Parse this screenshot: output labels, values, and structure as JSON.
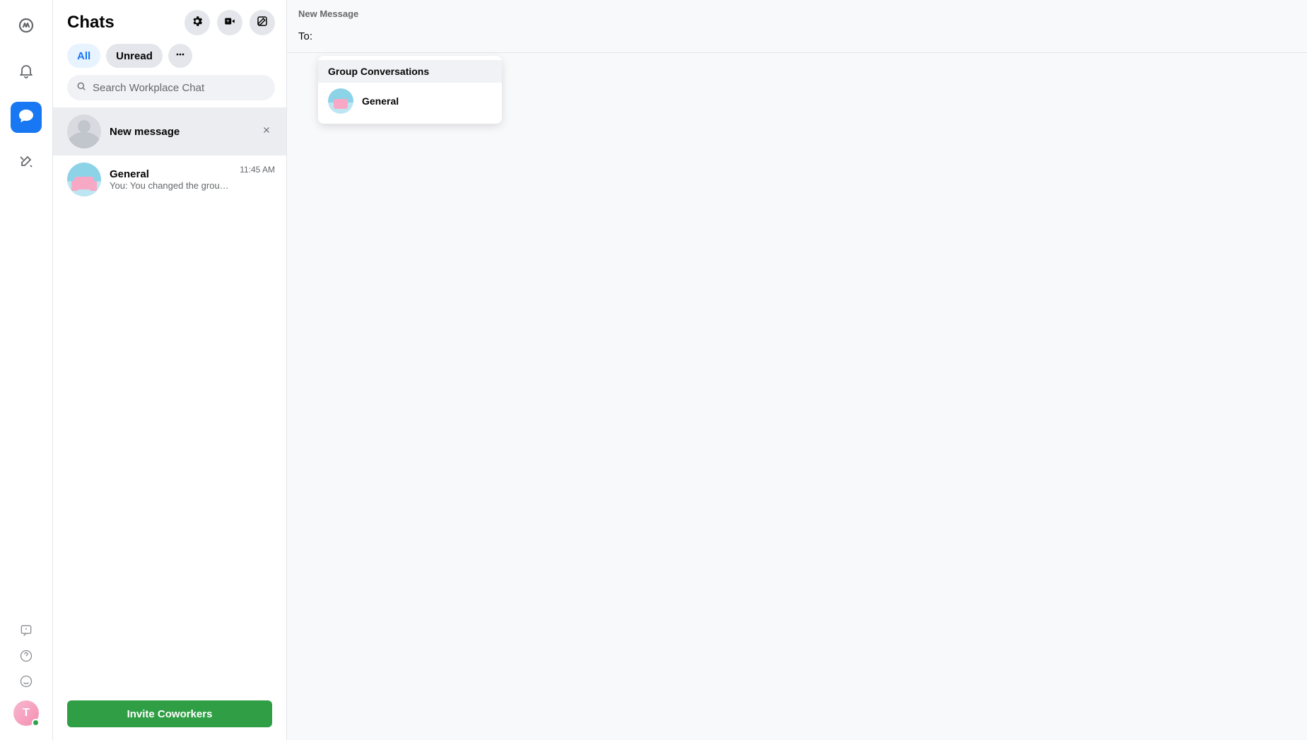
{
  "rail": {
    "avatar_letter": "T"
  },
  "sidebar": {
    "title": "Chats",
    "filter_all": "All",
    "filter_unread": "Unread",
    "search_placeholder": "Search Workplace Chat",
    "new_message_row": "New message",
    "invite_button": "Invite Coworkers"
  },
  "chats": [
    {
      "name": "General",
      "preview": "You: You changed the group photo.",
      "time": "11:45 AM"
    }
  ],
  "compose": {
    "header": "New Message",
    "to_label": "To:",
    "suggest_header": "Group Conversations",
    "suggestions": [
      {
        "name": "General"
      }
    ]
  }
}
